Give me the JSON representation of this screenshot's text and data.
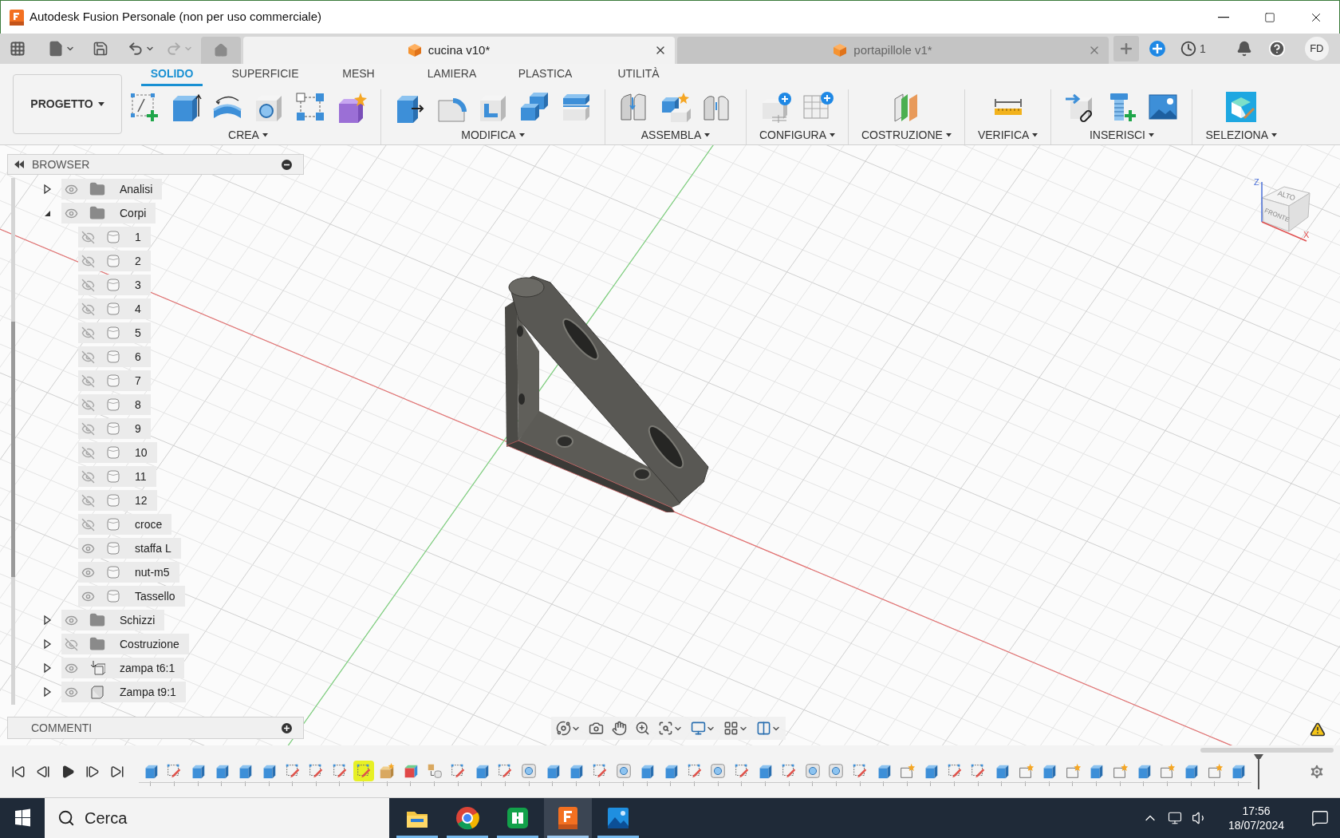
{
  "window": {
    "title": "Autodesk Fusion Personale (non per uso commerciale)"
  },
  "documents": [
    {
      "name": "cucina v10*",
      "selected": true
    },
    {
      "name": "portapillole v1*",
      "selected": false
    }
  ],
  "job_status": {
    "count": "1"
  },
  "user": {
    "initials": "FD"
  },
  "toolbar": {
    "project": "PROGETTO",
    "tabs": [
      {
        "label": "SOLIDO",
        "selected": true
      },
      {
        "label": "SUPERFICIE",
        "selected": false
      },
      {
        "label": "MESH",
        "selected": false
      },
      {
        "label": "LAMIERA",
        "selected": false
      },
      {
        "label": "PLASTICA",
        "selected": false
      },
      {
        "label": "UTILITÀ",
        "selected": false
      }
    ],
    "groups": [
      {
        "label": "CREA",
        "tools": [
          {
            "kind": "sketch"
          },
          {
            "kind": "extrude"
          },
          {
            "kind": "revolve"
          },
          {
            "kind": "hole"
          },
          {
            "kind": "pattern"
          },
          {
            "kind": "form"
          }
        ]
      },
      {
        "label": "MODIFICA",
        "tools": [
          {
            "kind": "pushpull"
          },
          {
            "kind": "fillet"
          },
          {
            "kind": "shell"
          },
          {
            "kind": "combine"
          },
          {
            "kind": "offset"
          }
        ]
      },
      {
        "label": "ASSEMBLA",
        "tools": [
          {
            "kind": "joint"
          },
          {
            "kind": "component"
          },
          {
            "kind": "rigid"
          }
        ]
      },
      {
        "label": "CONFIGURA",
        "tools": [
          {
            "kind": "configure"
          },
          {
            "kind": "table"
          }
        ]
      },
      {
        "label": "COSTRUZIONE",
        "tools": [
          {
            "kind": "plane"
          }
        ]
      },
      {
        "label": "VERIFICA",
        "tools": [
          {
            "kind": "measure"
          }
        ]
      },
      {
        "label": "INSERISCI",
        "tools": [
          {
            "kind": "derive"
          },
          {
            "kind": "fastener"
          },
          {
            "kind": "image"
          }
        ]
      },
      {
        "label": "SELEZIONA",
        "tools": [
          {
            "kind": "select"
          }
        ]
      }
    ]
  },
  "browser": {
    "title": "BROWSER",
    "items": [
      {
        "label": "Analisi",
        "kind": "folder",
        "visible": true,
        "expanded": false
      },
      {
        "label": "Corpi",
        "kind": "folder",
        "visible": true,
        "expanded": true,
        "children": [
          {
            "label": "1",
            "kind": "body",
            "visible": false
          },
          {
            "label": "2",
            "kind": "body",
            "visible": false
          },
          {
            "label": "3",
            "kind": "body",
            "visible": false
          },
          {
            "label": "4",
            "kind": "body",
            "visible": false
          },
          {
            "label": "5",
            "kind": "body",
            "visible": false
          },
          {
            "label": "6",
            "kind": "body",
            "visible": false
          },
          {
            "label": "7",
            "kind": "body",
            "visible": false
          },
          {
            "label": "8",
            "kind": "body",
            "visible": false
          },
          {
            "label": "9",
            "kind": "body",
            "visible": false
          },
          {
            "label": "10",
            "kind": "body",
            "visible": false
          },
          {
            "label": "11",
            "kind": "body",
            "visible": false
          },
          {
            "label": "12",
            "kind": "body",
            "visible": false
          },
          {
            "label": "croce",
            "kind": "body",
            "visible": false
          },
          {
            "label": "staffa L",
            "kind": "body",
            "visible": true
          },
          {
            "label": "nut-m5",
            "kind": "body",
            "visible": true
          },
          {
            "label": "Tassello",
            "kind": "body",
            "visible": true
          }
        ]
      },
      {
        "label": "Schizzi",
        "kind": "folder",
        "visible": true,
        "expanded": false
      },
      {
        "label": "Costruzione",
        "kind": "folder",
        "visible": false,
        "expanded": false
      },
      {
        "label": "zampa t6:1",
        "kind": "grounded",
        "visible": true,
        "expanded": false
      },
      {
        "label": "Zampa t9:1",
        "kind": "component",
        "visible": true,
        "expanded": false
      }
    ]
  },
  "comments": {
    "title": "COMMENTI"
  },
  "view_cube": {
    "top": "ALTO",
    "front": "FRONTE",
    "z_axis": "Z",
    "x_axis": "X"
  },
  "timeline": {
    "items": [
      {
        "kind": "extrude",
        "selected": false
      },
      {
        "kind": "sketch",
        "selected": false
      },
      {
        "kind": "extrude",
        "selected": false
      },
      {
        "kind": "extrude",
        "selected": false
      },
      {
        "kind": "extrude",
        "selected": false
      },
      {
        "kind": "extrude",
        "selected": false
      },
      {
        "kind": "sketch",
        "selected": false
      },
      {
        "kind": "sketch",
        "selected": false
      },
      {
        "kind": "sketch",
        "selected": false
      },
      {
        "kind": "sketch",
        "selected": true
      },
      {
        "kind": "component",
        "selected": false
      },
      {
        "kind": "appearance",
        "selected": false
      },
      {
        "kind": "joint",
        "selected": false
      },
      {
        "kind": "sketch",
        "selected": false
      },
      {
        "kind": "extrude",
        "selected": false
      },
      {
        "kind": "sketch",
        "selected": false
      },
      {
        "kind": "hole",
        "selected": false
      },
      {
        "kind": "extrude",
        "selected": false
      },
      {
        "kind": "extrude",
        "selected": false
      },
      {
        "kind": "sketch",
        "selected": false
      },
      {
        "kind": "hole",
        "selected": false
      },
      {
        "kind": "extrude",
        "selected": false
      },
      {
        "kind": "extrude",
        "selected": false
      },
      {
        "kind": "sketch",
        "selected": false
      },
      {
        "kind": "hole",
        "selected": false
      },
      {
        "kind": "sketch",
        "selected": false
      },
      {
        "kind": "extrude",
        "selected": false
      },
      {
        "kind": "sketch",
        "selected": false
      },
      {
        "kind": "hole",
        "selected": false
      },
      {
        "kind": "hole",
        "selected": false
      },
      {
        "kind": "sketch",
        "selected": false
      },
      {
        "kind": "extrude",
        "selected": false
      },
      {
        "kind": "fillet",
        "selected": false
      },
      {
        "kind": "extrude",
        "selected": false
      },
      {
        "kind": "sketch",
        "selected": false
      },
      {
        "kind": "sketch",
        "selected": false
      },
      {
        "kind": "extrude",
        "selected": false
      },
      {
        "kind": "fillet",
        "selected": false
      },
      {
        "kind": "extrude",
        "selected": false
      },
      {
        "kind": "fillet",
        "selected": false
      },
      {
        "kind": "extrude",
        "selected": false
      },
      {
        "kind": "fillet",
        "selected": false
      },
      {
        "kind": "extrude",
        "selected": false
      },
      {
        "kind": "fillet",
        "selected": false
      },
      {
        "kind": "extrude",
        "selected": false
      },
      {
        "kind": "fillet",
        "selected": false
      },
      {
        "kind": "extrude",
        "selected": false
      }
    ]
  },
  "taskbar": {
    "search": {
      "placeholder": "Cerca"
    },
    "apps": [
      {
        "kind": "explorer",
        "active": false
      },
      {
        "kind": "chrome",
        "active": false
      },
      {
        "kind": "sheets",
        "active": false
      },
      {
        "kind": "fusion",
        "active": true
      },
      {
        "kind": "photos",
        "active": false
      }
    ],
    "time": "17:56",
    "date": "18/07/2024"
  }
}
